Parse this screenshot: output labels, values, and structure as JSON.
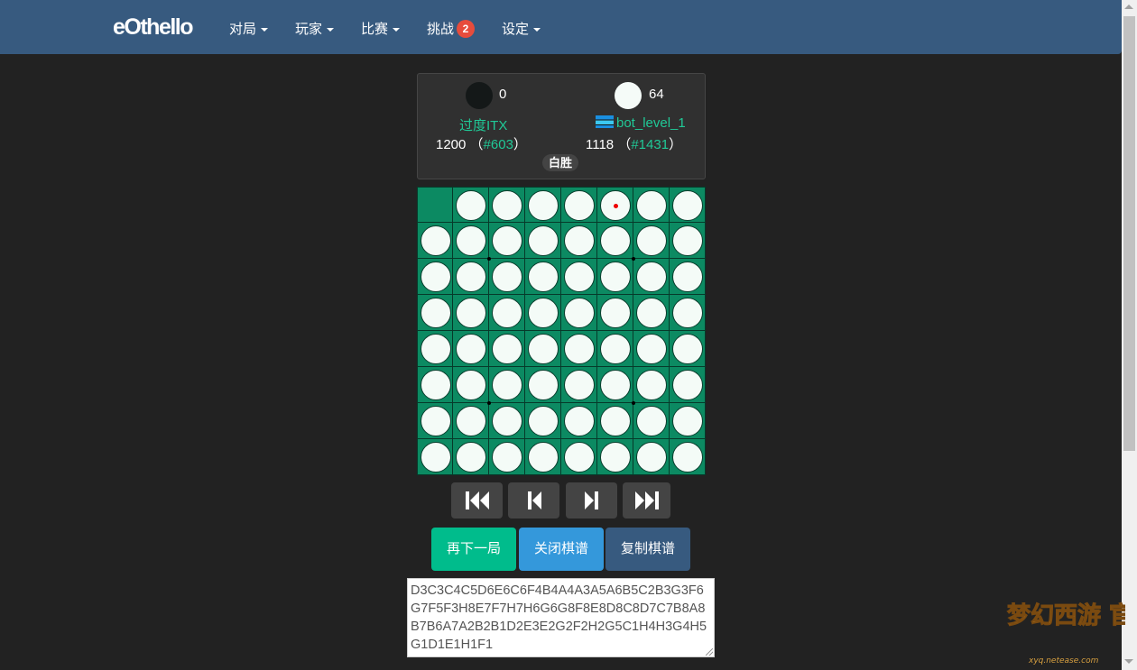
{
  "navbar": {
    "brand": "eOthello",
    "items": [
      {
        "label": "对局",
        "dropdown": true
      },
      {
        "label": "玩家",
        "dropdown": true
      },
      {
        "label": "比赛",
        "dropdown": true
      },
      {
        "label": "挑战",
        "badge": "2"
      },
      {
        "label": "设定",
        "dropdown": true
      }
    ]
  },
  "game": {
    "black": {
      "score": "0",
      "name": "过度ITX",
      "rating": "1200",
      "rank": "#603"
    },
    "white": {
      "score": "64",
      "name": "bot_level_1",
      "rating": "1118",
      "rank": "#1431",
      "flag_icon": "flag-icon"
    },
    "result": "白胜",
    "board": {
      "size": 8,
      "rows": [
        ".WWWWWWW",
        "WWWWWWWW",
        "WWWWWWWW",
        "WWWWWWWW",
        "WWWWWWWW",
        "WWWWWWWW",
        "WWWWWWWW",
        "WWWWWWWW"
      ],
      "last_move": "F1",
      "colors": {
        "board": "#0c8a62",
        "grid": "#063a2a",
        "white_disc": "#f4fbf7",
        "black_disc": "#141818",
        "last_move_marker": "#e00000"
      }
    }
  },
  "controls": {
    "icons": [
      "skip-to-start-icon",
      "step-back-icon",
      "step-forward-icon",
      "skip-to-end-icon"
    ]
  },
  "actions": {
    "play_again": "再下一局",
    "close_record": "关闭棋谱",
    "copy_record": "复制棋谱"
  },
  "record_text": "D3C3C4C5D6E6C6F4B4A4A3A5A6B5C2B3G3F6G7F5F3H8E7F7H7H6G6G8F8E8D8C8D7C7B8A8B7B6A7A2B2B1D2E3E2G2F2H2G5C1H4H3G4H5G1D1E1H1F1",
  "watermark": {
    "text": "梦幻西游 官方论坛",
    "url_text": "xyq.netease.com"
  },
  "theme": {
    "navbar": "#375a7f",
    "background": "#222222",
    "accent": "#00bc8c",
    "link": "#20c997"
  }
}
